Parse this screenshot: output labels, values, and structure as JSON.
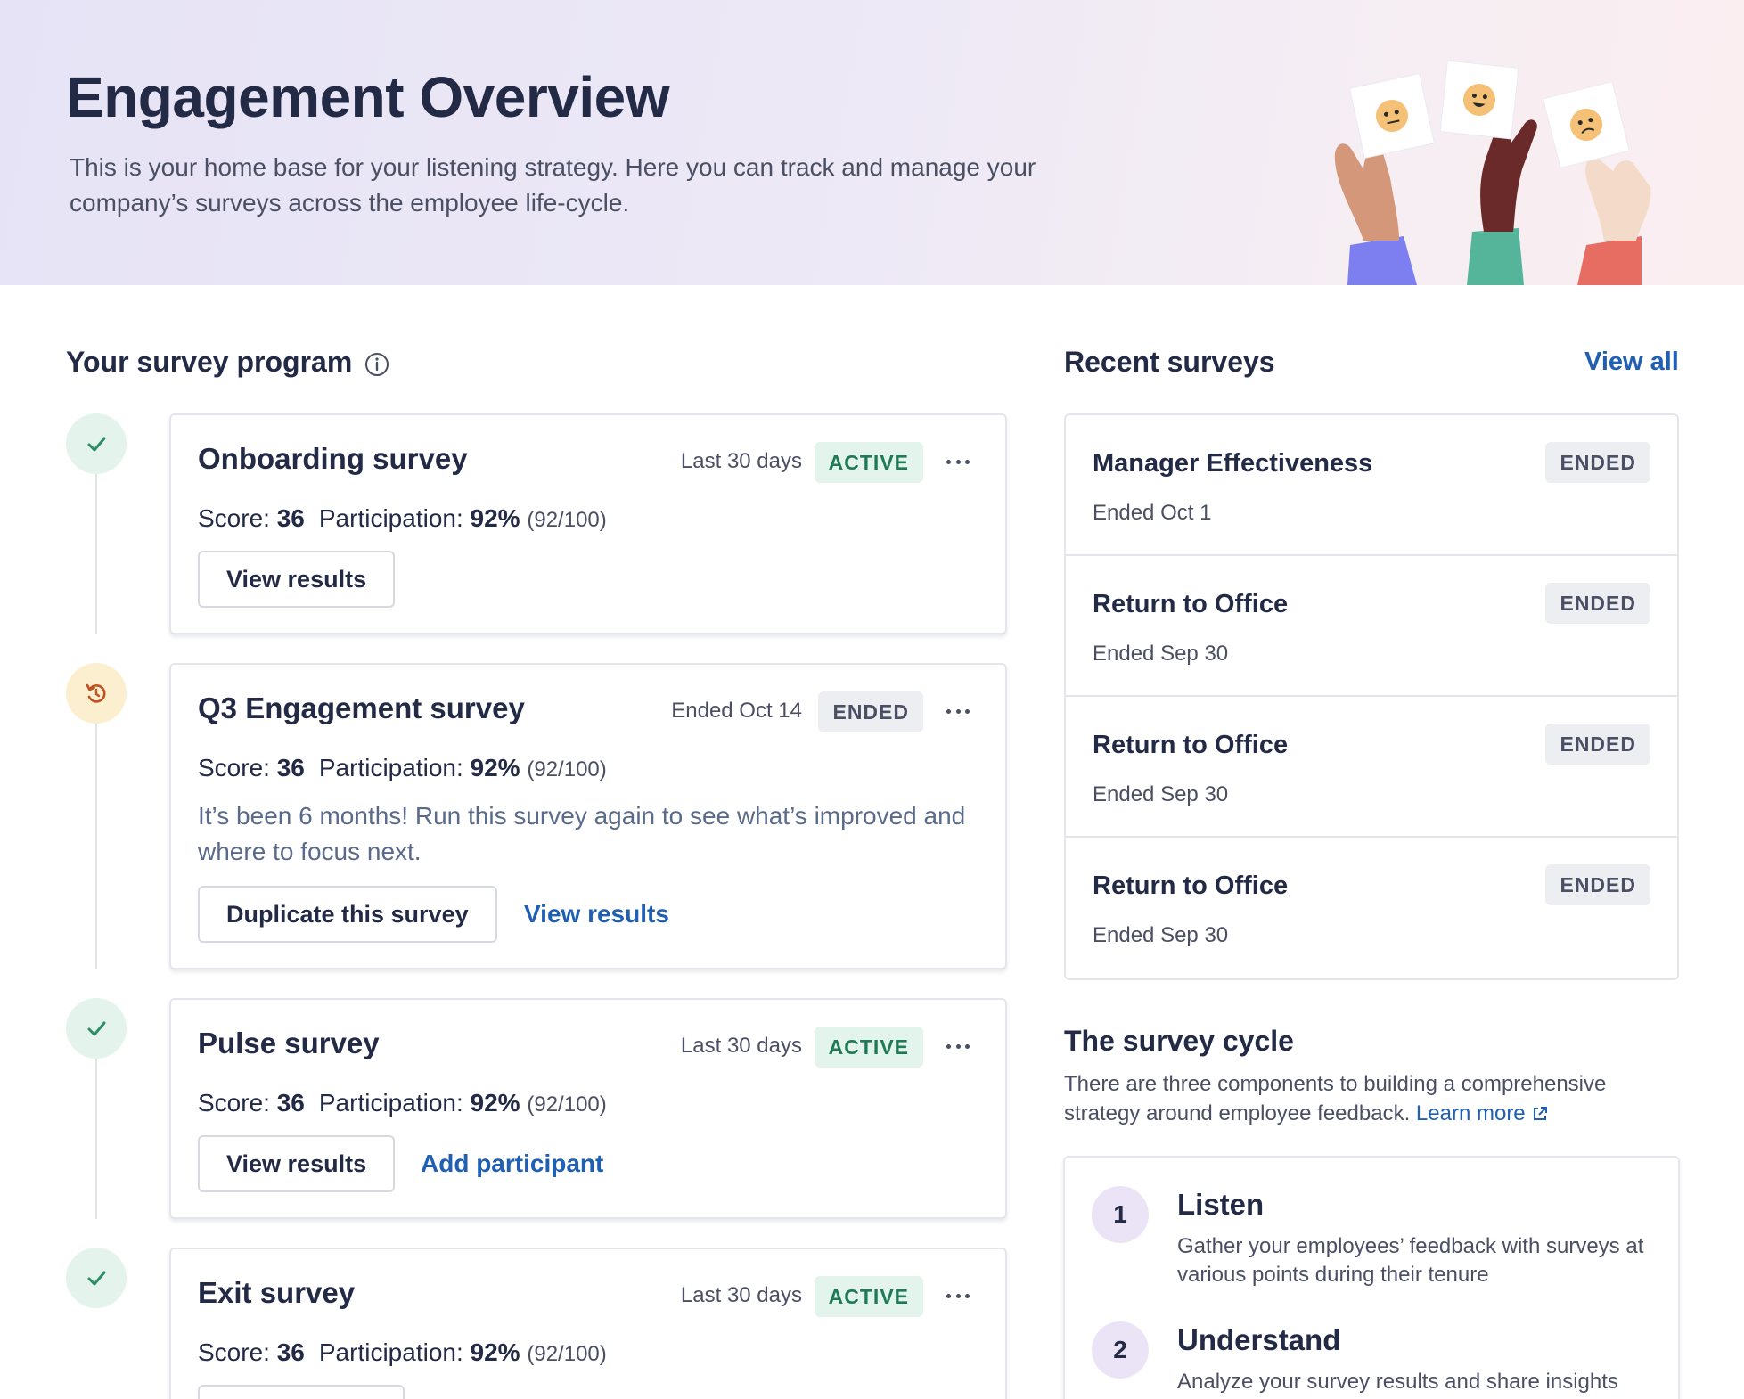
{
  "header": {
    "title": "Engagement Overview",
    "description": "This is your home base for your listening strategy. Here you can track and manage your company’s surveys across the employee life-cycle."
  },
  "program": {
    "title": "Your survey program",
    "score_label": "Score:",
    "participation_label": "Participation:",
    "surveys": [
      {
        "title": "Onboarding survey",
        "meta": "Last 30 days",
        "status": "ACTIVE",
        "score": "36",
        "participation": "92%",
        "participation_detail": "(92/100)",
        "button": "View results"
      },
      {
        "title": "Q3 Engagement survey",
        "meta": "Ended Oct 14",
        "status": "ENDED",
        "score": "36",
        "participation": "92%",
        "participation_detail": "(92/100)",
        "note": "It’s been 6 months! Run this survey again to see what’s improved and where to focus next.",
        "button": "Duplicate this survey",
        "link": "View results"
      },
      {
        "title": "Pulse survey",
        "meta": "Last 30 days",
        "status": "ACTIVE",
        "score": "36",
        "participation": "92%",
        "participation_detail": "(92/100)",
        "button": "View results",
        "link": "Add participant"
      },
      {
        "title": "Exit survey",
        "meta": "Last 30 days",
        "status": "ACTIVE",
        "score": "36",
        "participation": "92%",
        "participation_detail": "(92/100)"
      }
    ]
  },
  "recent": {
    "title": "Recent surveys",
    "view_all": "View all",
    "items": [
      {
        "title": "Manager Effectiveness",
        "date": "Ended Oct 1",
        "status": "ENDED"
      },
      {
        "title": "Return to Office",
        "date": "Ended Sep 30",
        "status": "ENDED"
      },
      {
        "title": "Return to Office",
        "date": "Ended Sep 30",
        "status": "ENDED"
      },
      {
        "title": "Return to Office",
        "date": "Ended Sep 30",
        "status": "ENDED"
      }
    ]
  },
  "cycle": {
    "title": "The survey cycle",
    "description": "There are three components to building a comprehensive strategy around employee feedback.",
    "learn_more": "Learn more",
    "steps": [
      {
        "num": "1",
        "title": "Listen",
        "desc": "Gather your employees’ feedback with surveys at various points during their tenure"
      },
      {
        "num": "2",
        "title": "Understand",
        "desc": "Analyze your survey results and share insights"
      }
    ]
  },
  "colors": {
    "accent_link": "#1f5fb4",
    "active_badge": "#e3f4ed",
    "ended_badge": "#eceef2"
  }
}
